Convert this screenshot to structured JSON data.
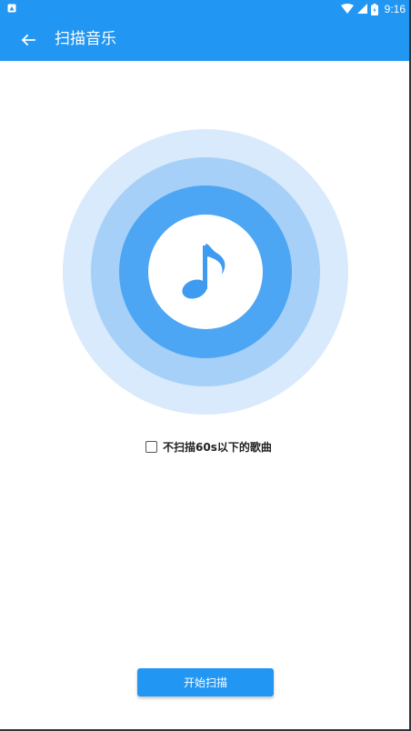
{
  "status_bar": {
    "time": "9:16",
    "icons": [
      "notification-icon",
      "wifi-icon",
      "signal-icon",
      "battery-icon"
    ]
  },
  "app_bar": {
    "title": "扫描音乐",
    "back_icon": "arrow-back-icon"
  },
  "scan_illustration": {
    "icon": "music-note-icon"
  },
  "options": {
    "skip_short_label": "不扫描60s以下的歌曲",
    "skip_short_checked": false
  },
  "actions": {
    "start_label": "开始扫描"
  },
  "colors": {
    "primary": "#2196F3",
    "ring_outer": "#D8EAFC",
    "ring_middle": "#A6D0F7",
    "ring_inner": "#4DA6F3"
  }
}
